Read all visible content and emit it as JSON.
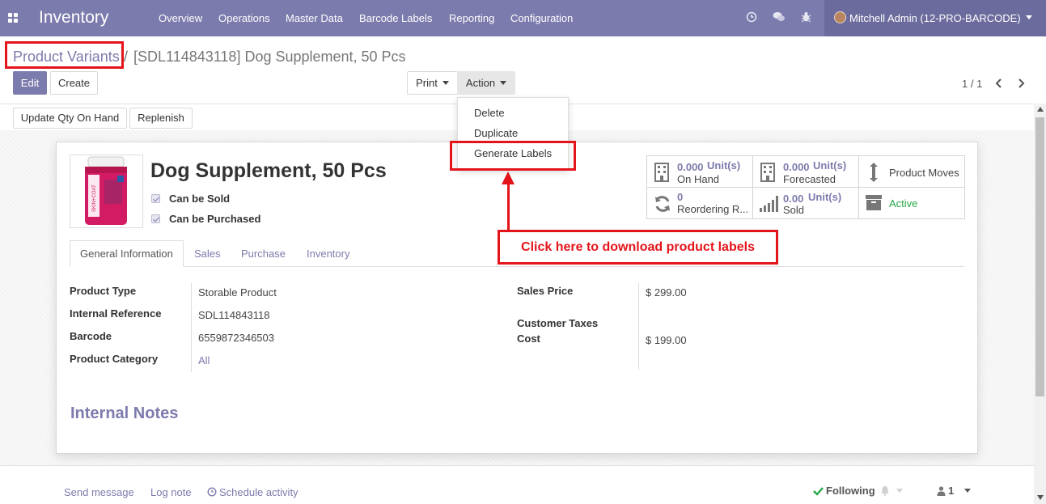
{
  "navbar": {
    "app_title": "Inventory",
    "menu": [
      "Overview",
      "Operations",
      "Master Data",
      "Barcode Labels",
      "Reporting",
      "Configuration"
    ],
    "user": "Mitchell Admin (12-PRO-BARCODE)"
  },
  "breadcrumb": {
    "parent": "Product Variants",
    "separator": "/",
    "current": "[SDL114843118] Dog Supplement, 50 Pcs"
  },
  "toolbar": {
    "edit": "Edit",
    "create": "Create",
    "print": "Print",
    "action": "Action",
    "pager": "1 / 1"
  },
  "action_menu": {
    "items": [
      "Delete",
      "Duplicate",
      "Generate Labels"
    ]
  },
  "header_buttons": {
    "update_qty": "Update Qty On Hand",
    "replenish": "Replenish"
  },
  "product": {
    "name": "Dog Supplement, 50 Pcs",
    "can_be_sold": "Can be Sold",
    "can_be_purchased": "Can be Purchased",
    "image_text": "SKIN+COAT"
  },
  "stats": {
    "on_hand_value": "0.000",
    "on_hand_unit": "Unit(s)",
    "on_hand_label": "On Hand",
    "forecast_value": "0.000",
    "forecast_unit": "Unit(s)",
    "forecast_label": "Forecasted",
    "moves_label": "Product Moves",
    "reorder_value": "0",
    "reorder_label": "Reordering R...",
    "sold_value": "0.00",
    "sold_unit": "Unit(s)",
    "sold_label": "Sold",
    "active_label": "Active"
  },
  "callout": "Click here to download product labels",
  "tabs": [
    "General Information",
    "Sales",
    "Purchase",
    "Inventory"
  ],
  "fields": {
    "product_type_label": "Product Type",
    "product_type": "Storable Product",
    "internal_ref_label": "Internal Reference",
    "internal_ref": "SDL114843118",
    "barcode_label": "Barcode",
    "barcode": "6559872346503",
    "category_label": "Product Category",
    "category": "All",
    "sales_price_label": "Sales Price",
    "sales_price": "$ 299.00",
    "customer_taxes_label": "Customer Taxes",
    "cost_label": "Cost",
    "cost": "$ 199.00"
  },
  "notes_title": "Internal Notes",
  "chatter": {
    "send_message": "Send message",
    "log_note": "Log note",
    "schedule_activity": "Schedule activity",
    "following": "Following",
    "followers_count": "1"
  },
  "colors": {
    "brand": "#7c7bad",
    "annotation_red": "#e4141b",
    "active_green": "#28a745"
  }
}
